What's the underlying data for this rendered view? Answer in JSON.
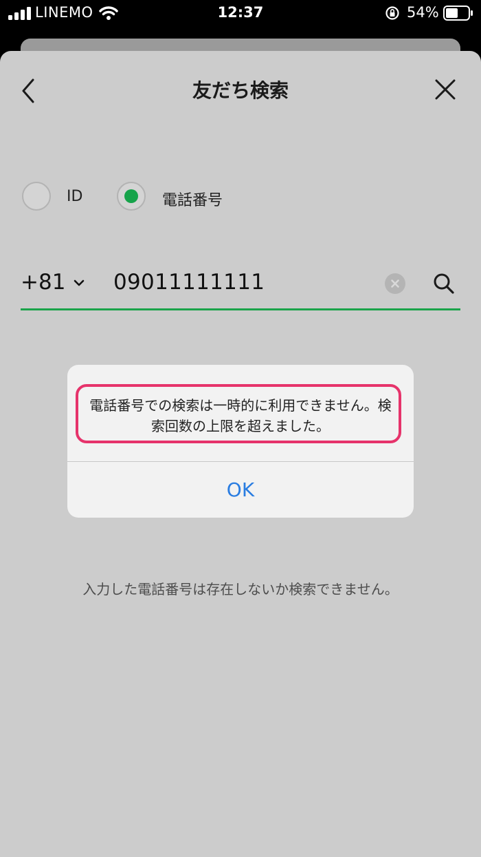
{
  "status_bar": {
    "carrier": "LINEMO",
    "time": "12:37",
    "battery_percent": "54%"
  },
  "nav": {
    "title": "友だち検索"
  },
  "search_type": {
    "options": [
      {
        "label": "ID",
        "selected": false
      },
      {
        "label": "電話番号",
        "selected": true
      }
    ]
  },
  "phone_search": {
    "country_code": "+81",
    "value": "09011111111"
  },
  "result_message": "入力した電話番号は存在しないか検索できません。",
  "alert": {
    "message": "電話番号での検索は一時的に利用できません。検索回数の上限を超えました。",
    "ok_label": "OK"
  },
  "colors": {
    "accent_green": "#1aa34a",
    "highlight_pink": "#e6336b",
    "link_blue": "#2a7de1"
  }
}
